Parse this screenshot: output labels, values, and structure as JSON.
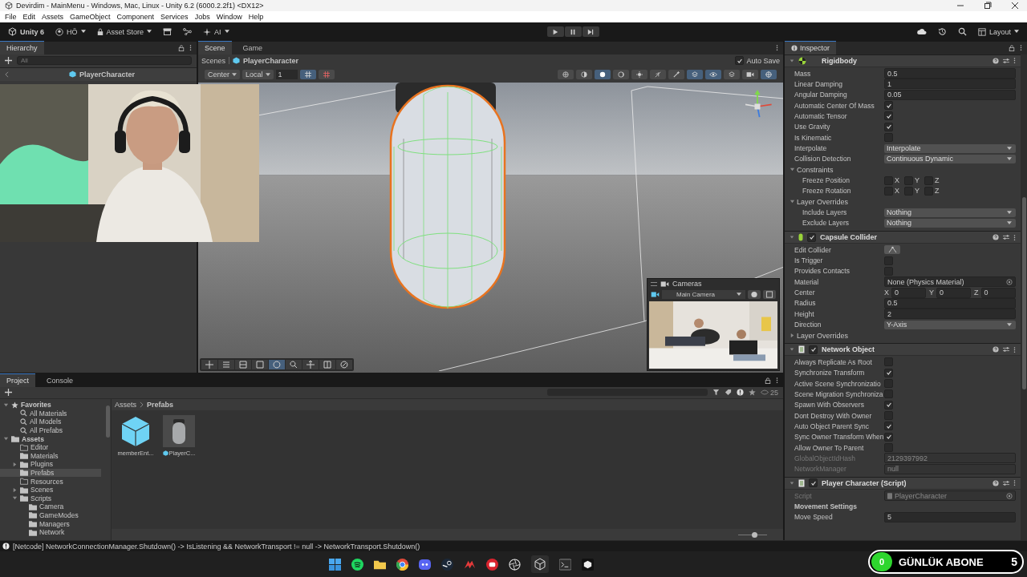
{
  "window": {
    "title": "Devirdim - MainMenu - Windows, Mac, Linux - Unity 6.2 (6000.2.2f1) <DX12>"
  },
  "menu": [
    "File",
    "Edit",
    "Assets",
    "GameObject",
    "Component",
    "Services",
    "Jobs",
    "Window",
    "Help"
  ],
  "toolbar": {
    "account": "Unity 6",
    "user": "HÖ",
    "asset_store": "Asset Store",
    "ai": "AI",
    "layout": "Layout",
    "playing": false
  },
  "hierarchy": {
    "tab": "Hierarchy",
    "search_placeholder": "All",
    "scene": "PlayerCharacter"
  },
  "scene": {
    "tabs": [
      {
        "label": "Scene",
        "selected": true
      },
      {
        "label": "Game",
        "selected": false
      }
    ],
    "breadcrumb": [
      "Scenes",
      "PlayerCharacter"
    ],
    "auto_save": {
      "label": "Auto Save",
      "checked": true
    },
    "pivot": "Center",
    "space": "Local",
    "grid_size": "1",
    "cameras": {
      "title": "Cameras",
      "camera": "Main Camera"
    }
  },
  "inspector": {
    "tab": "Inspector",
    "components": [
      {
        "name": "Rigidbody",
        "kind": "rigidbody",
        "rows": [
          {
            "kind": "field",
            "label": "Mass",
            "value": "0.5"
          },
          {
            "kind": "field",
            "label": "Linear Damping",
            "value": "1"
          },
          {
            "kind": "field",
            "label": "Angular Damping",
            "value": "0.05"
          },
          {
            "kind": "check",
            "label": "Automatic Center Of Mass",
            "checked": true
          },
          {
            "kind": "check",
            "label": "Automatic Tensor",
            "checked": true
          },
          {
            "kind": "check",
            "label": "Use Gravity",
            "checked": true
          },
          {
            "kind": "check",
            "label": "Is Kinematic",
            "checked": false
          },
          {
            "kind": "dropdown",
            "label": "Interpolate",
            "value": "Interpolate"
          },
          {
            "kind": "dropdown",
            "label": "Collision Detection",
            "value": "Continuous Dynamic"
          },
          {
            "kind": "foldout",
            "label": "Constraints",
            "expanded": true,
            "children": [
              {
                "kind": "axes",
                "label": "Freeze Position",
                "axes": [
                  {
                    "label": "X",
                    "checked": false
                  },
                  {
                    "label": "Y",
                    "checked": false
                  },
                  {
                    "label": "Z",
                    "checked": false
                  }
                ]
              },
              {
                "kind": "axes",
                "label": "Freeze Rotation",
                "axes": [
                  {
                    "label": "X",
                    "checked": false
                  },
                  {
                    "label": "Y",
                    "checked": false
                  },
                  {
                    "label": "Z",
                    "checked": false
                  }
                ]
              }
            ]
          },
          {
            "kind": "foldout",
            "label": "Layer Overrides",
            "expanded": true,
            "children": [
              {
                "kind": "dropdown",
                "label": "Include Layers",
                "value": "Nothing"
              },
              {
                "kind": "dropdown",
                "label": "Exclude Layers",
                "value": "Nothing"
              }
            ]
          }
        ]
      },
      {
        "name": "Capsule Collider",
        "kind": "collider",
        "enabled": true,
        "rows": [
          {
            "kind": "button",
            "label": "Edit Collider"
          },
          {
            "kind": "check",
            "label": "Is Trigger",
            "checked": false
          },
          {
            "kind": "check",
            "label": "Provides Contacts",
            "checked": false
          },
          {
            "kind": "object",
            "label": "Material",
            "value": "None (Physics Material)"
          },
          {
            "kind": "vector",
            "label": "Center",
            "axes": [
              {
                "label": "X",
                "value": "0"
              },
              {
                "label": "Y",
                "value": "0"
              },
              {
                "label": "Z",
                "value": "0"
              }
            ]
          },
          {
            "kind": "field",
            "label": "Radius",
            "value": "0.5"
          },
          {
            "kind": "field",
            "label": "Height",
            "value": "2"
          },
          {
            "kind": "dropdown",
            "label": "Direction",
            "value": "Y-Axis"
          },
          {
            "kind": "foldout",
            "label": "Layer Overrides",
            "expanded": false
          }
        ]
      },
      {
        "name": "Network Object",
        "kind": "script",
        "enabled": true,
        "rows": [
          {
            "kind": "check",
            "label": "Always Replicate As Root",
            "checked": false
          },
          {
            "kind": "check",
            "label": "Synchronize Transform",
            "checked": true
          },
          {
            "kind": "check",
            "label": "Active Scene Synchronizatio",
            "checked": false
          },
          {
            "kind": "check",
            "label": "Scene Migration Synchroniza",
            "checked": false
          },
          {
            "kind": "check",
            "label": "Spawn With Observers",
            "checked": true
          },
          {
            "kind": "check",
            "label": "Dont Destroy With Owner",
            "checked": false
          },
          {
            "kind": "check",
            "label": "Auto Object Parent Sync",
            "checked": true
          },
          {
            "kind": "check",
            "label": "Sync Owner Transform When",
            "checked": true
          },
          {
            "kind": "check",
            "label": "Allow Owner To Parent",
            "checked": false
          },
          {
            "kind": "field",
            "label": "GlobalObjectIdHash",
            "value": "2129397992",
            "disabled": true
          },
          {
            "kind": "field",
            "label": "NetworkManager",
            "value": "null",
            "disabled": true
          }
        ]
      },
      {
        "name": "Player Character (Script)",
        "kind": "script",
        "enabled": true,
        "rows": [
          {
            "kind": "object",
            "label": "Script",
            "value": "PlayerCharacter",
            "disabled": true
          },
          {
            "kind": "heading",
            "label": "Movement Settings"
          },
          {
            "kind": "field",
            "label": "Move Speed",
            "value": "5"
          }
        ]
      }
    ]
  },
  "project": {
    "tabs": [
      {
        "label": "Project",
        "selected": true
      },
      {
        "label": "Console",
        "selected": false
      }
    ],
    "tree": [
      {
        "label": "Favorites",
        "kind": "favorites",
        "expanded": true,
        "children": [
          {
            "label": "All Materials",
            "kind": "search"
          },
          {
            "label": "All Models",
            "kind": "search"
          },
          {
            "label": "All Prefabs",
            "kind": "search"
          }
        ]
      },
      {
        "label": "Assets",
        "kind": "folder",
        "expanded": true,
        "selected": false,
        "children": [
          {
            "label": "Editor",
            "kind": "empty-folder",
            "selected": false
          },
          {
            "label": "Materials",
            "kind": "folder",
            "selected": false
          },
          {
            "label": "Plugins",
            "kind": "folder",
            "expanded": false,
            "selected": false
          },
          {
            "label": "Prefabs",
            "kind": "folder",
            "selected": true
          },
          {
            "label": "Resources",
            "kind": "empty-folder",
            "selected": false
          },
          {
            "label": "Scenes",
            "kind": "folder",
            "expanded": false,
            "selected": false
          },
          {
            "label": "Scripts",
            "kind": "folder",
            "expanded": true,
            "selected": false,
            "children": [
              {
                "label": "Camera",
                "kind": "folder",
                "selected": false
              },
              {
                "label": "GameModes",
                "kind": "folder",
                "selected": false
              },
              {
                "label": "Managers",
                "kind": "folder",
                "selected": false
              },
              {
                "label": "Network",
                "kind": "folder",
                "selected": false
              }
            ]
          }
        ]
      }
    ],
    "breadcrumb": [
      "Assets",
      "Prefabs"
    ],
    "hidden_count": "25",
    "assets": [
      {
        "name": "memberEnt...",
        "kind": "cube",
        "selected": false
      },
      {
        "name": "PlayerC...",
        "kind": "prefab",
        "selected": false
      }
    ],
    "zoom": {
      "level": 0.55
    }
  },
  "status_bar": {
    "message": "[Netcode] NetworkConnectionManager.Shutdown() -> IsListening && NetworkTransport != null -> NetworkTransport.Shutdown()"
  },
  "subscriber_overlay": {
    "count": "0",
    "label": "GÜNLÜK ABONE",
    "goal": "5"
  }
}
